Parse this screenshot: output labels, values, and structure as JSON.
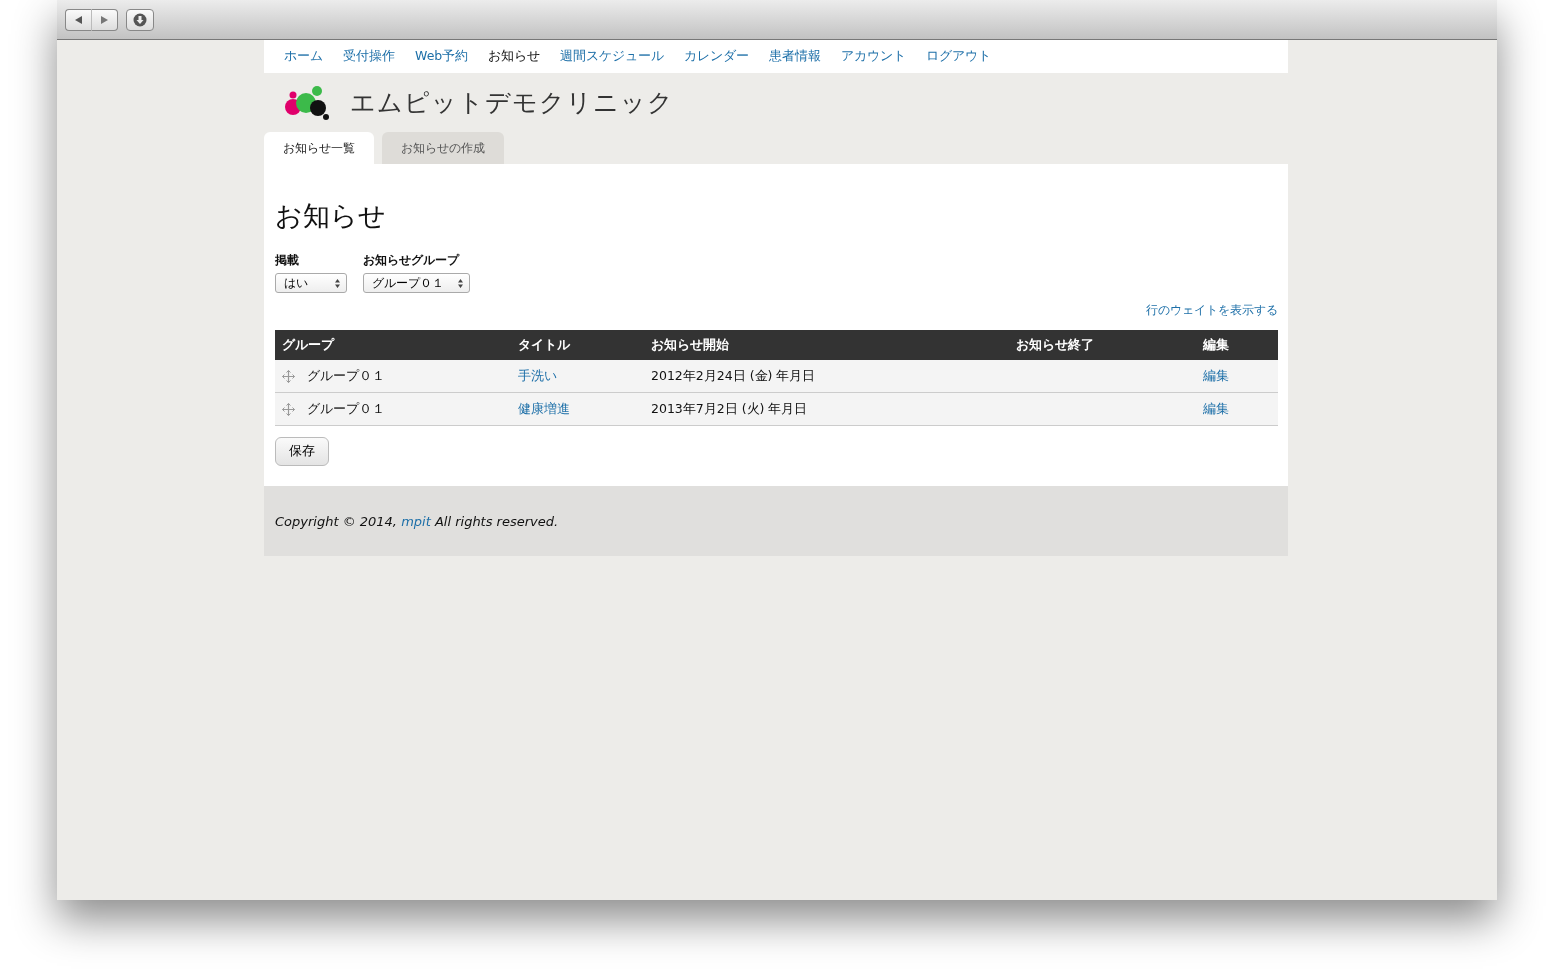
{
  "nav": [
    {
      "label": "ホーム",
      "selected": false
    },
    {
      "label": "受付操作",
      "selected": false
    },
    {
      "label": "Web予約",
      "selected": false
    },
    {
      "label": "お知らせ",
      "selected": true
    },
    {
      "label": "週間スケジュール",
      "selected": false
    },
    {
      "label": "カレンダー",
      "selected": false
    },
    {
      "label": "患者情報",
      "selected": false
    },
    {
      "label": "アカウント",
      "selected": false
    },
    {
      "label": "ログアウト",
      "selected": false
    }
  ],
  "site_name": "エムピットデモクリニック",
  "tabs": [
    {
      "label": "お知らせ一覧",
      "selected": true
    },
    {
      "label": "お知らせの作成",
      "selected": false
    }
  ],
  "heading": "お知らせ",
  "filters": [
    {
      "label": "掲載",
      "value": "はい"
    },
    {
      "label": "お知らせグループ",
      "value": "グループ０１"
    }
  ],
  "weight_link": "行のウェイトを表示する",
  "table": {
    "columns": [
      "グループ",
      "タイトル",
      "お知らせ開始",
      "お知らせ終了",
      "編集"
    ],
    "rows": [
      {
        "group": "グループ０１",
        "title": "手洗い",
        "start": "2012年2月24日 (金) 年月日",
        "edit": "編集"
      },
      {
        "group": "グループ０１",
        "title": "健康増進",
        "start": "2013年7月2日 (火) 年月日",
        "edit": "編集"
      }
    ]
  },
  "save_button": "保存",
  "footer": {
    "prefix": "Copyright © 2014,",
    "link": "mpit",
    "suffix": "All rights reserved."
  }
}
